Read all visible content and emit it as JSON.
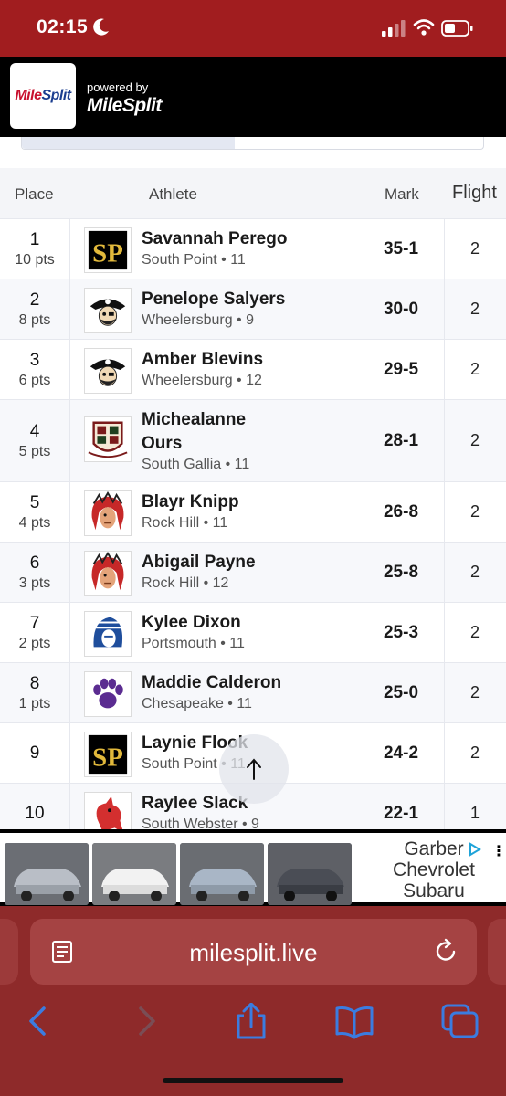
{
  "status_bar": {
    "time": "02:15"
  },
  "header": {
    "logo_text_part1": "Mile",
    "logo_text_part2": "Split",
    "powered_by": "powered by",
    "powered_logo": "MileSplit"
  },
  "table": {
    "headers": {
      "place": "Place",
      "athlete": "Athlete",
      "mark": "Mark",
      "flight": "Flight"
    },
    "rows": [
      {
        "place": "1",
        "pts": "10 pts",
        "name": "Savannah Perego",
        "team": "South Point • 11",
        "mark": "35-1",
        "flight": "2",
        "logo": "south-point-logo"
      },
      {
        "place": "2",
        "pts": "8 pts",
        "name": "Penelope Salyers",
        "team": "Wheelersburg • 9",
        "mark": "30-0",
        "flight": "2",
        "logo": "wheelersburg-pirate-logo"
      },
      {
        "place": "3",
        "pts": "6 pts",
        "name": "Amber Blevins",
        "team": "Wheelersburg • 12",
        "mark": "29-5",
        "flight": "2",
        "logo": "wheelersburg-pirate-logo"
      },
      {
        "place": "4",
        "pts": "5 pts",
        "name": "Michealanne Ours",
        "name_line1": "Michealanne",
        "name_line2": "Ours",
        "team": "South Gallia • 11",
        "mark": "28-1",
        "flight": "2",
        "logo": "south-gallia-crest-logo"
      },
      {
        "place": "5",
        "pts": "4 pts",
        "name": "Blayr Knipp",
        "team": "Rock Hill • 11",
        "mark": "26-8",
        "flight": "2",
        "logo": "rock-hill-chief-logo"
      },
      {
        "place": "6",
        "pts": "3 pts",
        "name": "Abigail Payne",
        "team": "Rock Hill • 12",
        "mark": "25-8",
        "flight": "2",
        "logo": "rock-hill-chief-logo"
      },
      {
        "place": "7",
        "pts": "2 pts",
        "name": "Kylee Dixon",
        "team": "Portsmouth • 11",
        "mark": "25-3",
        "flight": "2",
        "logo": "portsmouth-trojan-logo"
      },
      {
        "place": "8",
        "pts": "1 pts",
        "name": "Maddie Calderon",
        "team": "Chesapeake • 11",
        "mark": "25-0",
        "flight": "2",
        "logo": "chesapeake-paw-logo"
      },
      {
        "place": "9",
        "pts": "",
        "name": "Laynie Flook",
        "team": "South Point • 11",
        "mark": "24-2",
        "flight": "2",
        "logo": "south-point-logo"
      },
      {
        "place": "10",
        "pts": "",
        "name": "Raylee Slack",
        "team": "South Webster • 9",
        "mark": "22-1",
        "flight": "1",
        "logo": "south-webster-logo"
      }
    ]
  },
  "ad": {
    "brand_line1": "Garber",
    "brand_line2": "Chevrolet",
    "brand_line3": "Subaru"
  },
  "browser": {
    "url": "milesplit.live"
  },
  "colors": {
    "status_bar": "#a11d1f",
    "chrome": "#8e2a2a",
    "accent_blue": "#3b7ce0"
  }
}
